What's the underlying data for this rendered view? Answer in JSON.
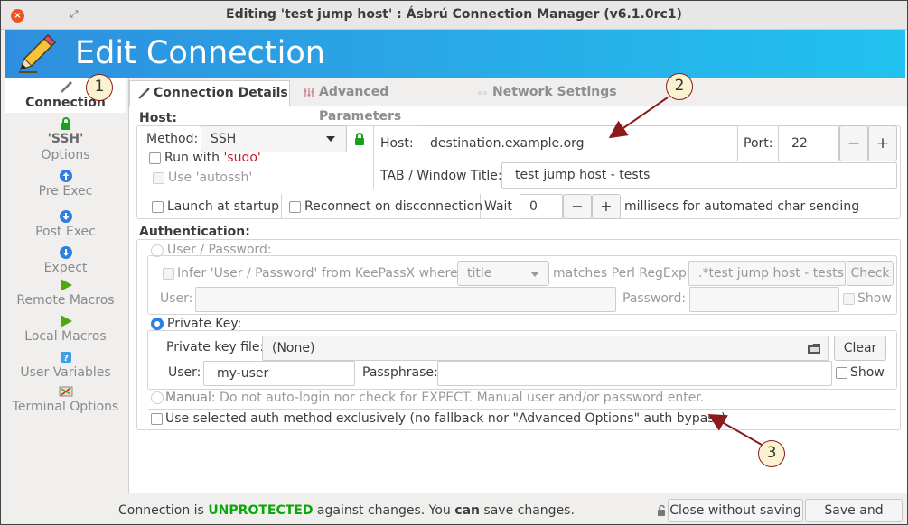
{
  "window": {
    "title": "Editing 'test jump host' : Ásbrú Connection Manager (v6.1.0rc1)",
    "close_glyph": "×",
    "min_glyph": "–",
    "max_glyph": "⤢"
  },
  "banner": {
    "title": "Edit Connection",
    "icon": "pencil-icon"
  },
  "sidebar": {
    "items": [
      {
        "label": "Connection",
        "icon": "connection-icon"
      },
      {
        "label": "'SSH'",
        "label2": "Options",
        "icon": "lock-icon"
      },
      {
        "label": "Pre Exec",
        "icon": "arrow-up-icon"
      },
      {
        "label": "Post Exec",
        "icon": "arrow-down-icon"
      },
      {
        "label": "Expect",
        "icon": "arrow-down-icon"
      },
      {
        "label": "Remote Macros",
        "icon": "play-icon"
      },
      {
        "label": "Local Macros",
        "icon": "play-icon"
      },
      {
        "label": "User Variables",
        "icon": "help-icon"
      },
      {
        "label": "Terminal Options",
        "icon": "terminal-icon"
      }
    ]
  },
  "tabs": [
    {
      "label": "Connection Details",
      "icon": "connection-icon"
    },
    {
      "label": "Advanced Parameters",
      "icon": "sliders-icon"
    },
    {
      "label": "Network Settings",
      "icon": "network-icon"
    }
  ],
  "host_section": {
    "header": "Host:",
    "method_label": "Method:",
    "method_value": "SSH",
    "run_with_prefix": "Run with ",
    "run_with_sudo": "'sudo'",
    "use_autossh": "Use 'autossh'",
    "host_label": "Host:",
    "host_value": "destination.example.org",
    "port_label": "Port:",
    "port_value": "22",
    "minus": "−",
    "plus": "+",
    "tab_title_label": "TAB / Window Title:",
    "tab_title_value": "test jump host - tests",
    "launch_at_startup": "Launch at startup",
    "reconnect": "Reconnect on disconnection",
    "wait_label": "Wait",
    "wait_value": "0",
    "millisecs_label": "millisecs for automated char sending"
  },
  "auth_section": {
    "header": "Authentication:",
    "user_password": "User / Password:",
    "infer_label": "Infer 'User / Password' from KeePassX where:",
    "infer_select": "title",
    "matches_label": "matches Perl RegExp:",
    "regexp_value": ".*test jump host - tests",
    "check_button": "Check",
    "user_label": "User:",
    "password_label": "Password:",
    "show_label": "Show",
    "private_key": "Private Key:",
    "key_file_label": "Private key file:",
    "key_file_value": "(None)",
    "clear_button": "Clear",
    "pk_user_label": "User:",
    "pk_user_value": "my-user",
    "passphrase_label": "Passphrase:",
    "pk_show_label": "Show",
    "manual_label": "Manual:",
    "manual_desc": "Do not auto-login nor check for EXPECT. Manual user and/or password enter.",
    "exclusive_label": "Use selected auth method exclusively (no fallback nor \"Advanced Options\" auth bypass)"
  },
  "statusbar": {
    "text_a": "Connection is ",
    "text_unprotected": "UNPROTECTED",
    "text_b": " against changes. You ",
    "text_can": "can",
    "text_c": " save changes.",
    "close_without_saving": "Close without saving",
    "save_and_close": "Save and Close"
  },
  "callouts": [
    "1",
    "2",
    "3"
  ],
  "colors": {
    "banner_start": "#2e8fde",
    "banner_end": "#21c2ef",
    "accent_red": "#c7162b",
    "accent_green": "#0ea60e",
    "radio_blue": "#2d7fe0",
    "callout_arrow": "#8b1a1a"
  }
}
